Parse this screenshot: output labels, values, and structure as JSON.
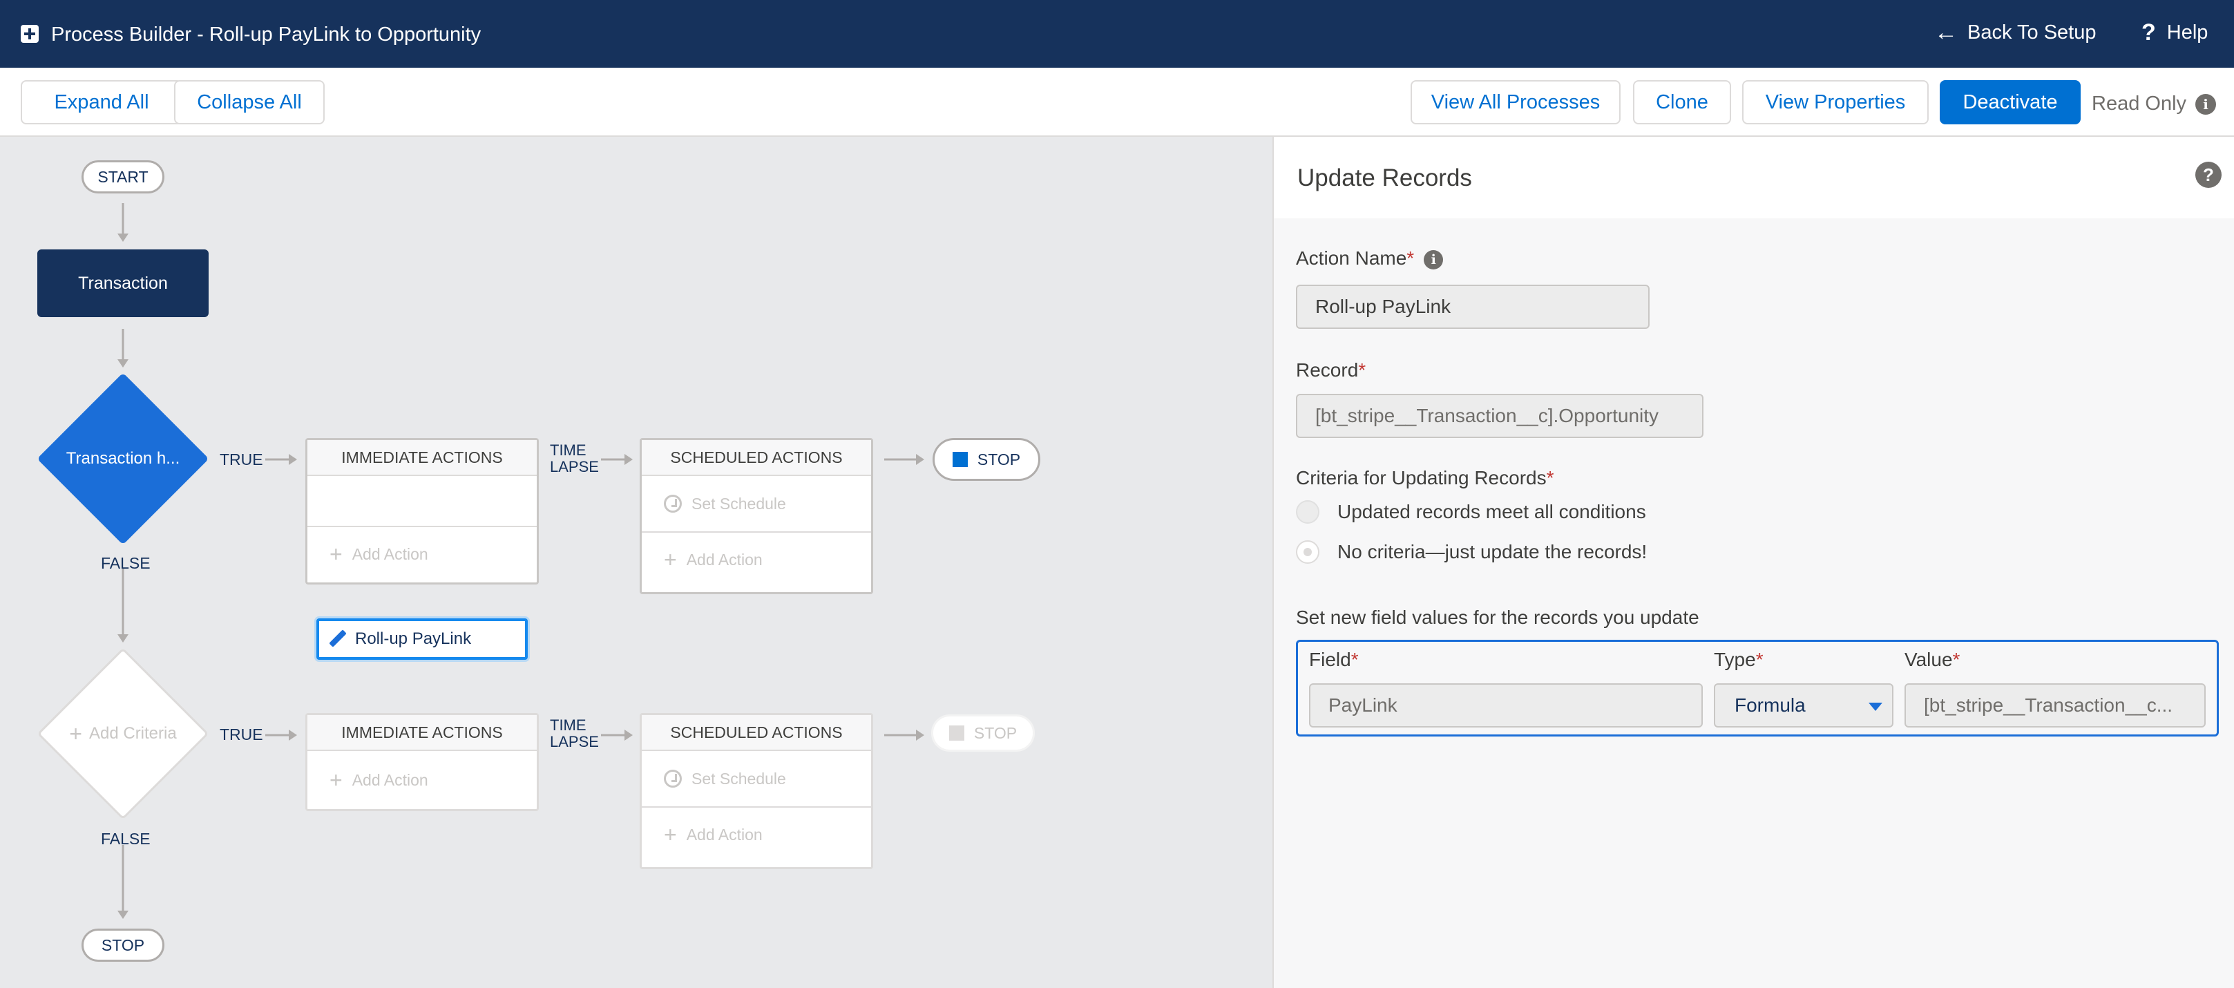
{
  "header": {
    "title": "Process Builder - Roll-up PayLink to Opportunity",
    "back_label": "Back To Setup",
    "help_label": "Help"
  },
  "toolbar": {
    "expand_all": "Expand All",
    "collapse_all": "Collapse All",
    "view_all_processes": "View All Processes",
    "clone": "Clone",
    "view_properties": "View Properties",
    "deactivate": "Deactivate",
    "read_only": "Read Only"
  },
  "canvas": {
    "start": "START",
    "object_node": "Transaction",
    "criteria_1": "Transaction h...",
    "criteria_2": "Add Criteria",
    "true_label": "TRUE",
    "false_label": "FALSE",
    "time_lapse_line1": "TIME",
    "time_lapse_line2": "LAPSE",
    "immediate_actions": "IMMEDIATE ACTIONS",
    "scheduled_actions": "SCHEDULED ACTIONS",
    "selected_action": "Roll-up PayLink",
    "add_action": "Add Action",
    "set_schedule": "Set Schedule",
    "stop": "STOP"
  },
  "panel": {
    "title": "Update Records",
    "action_name_label": "Action Name",
    "action_name_value": "Roll-up PayLink",
    "record_label": "Record",
    "record_value": "[bt_stripe__Transaction__c].Opportunity",
    "criteria_label": "Criteria for Updating Records",
    "criteria_option_1": "Updated records meet all conditions",
    "criteria_option_2": "No criteria—just update the records!",
    "set_values_label": "Set new field values for the records you update",
    "col_field": "Field",
    "col_type": "Type",
    "col_value": "Value",
    "row_field": "PayLink",
    "row_type": "Formula",
    "row_value": "[bt_stripe__Transaction__c..."
  },
  "colors": {
    "header_bg": "#16325c",
    "brand": "#0070d2",
    "criteria_blue": "#1b6ed8",
    "canvas_bg": "#e8e9eb",
    "required": "#c23934"
  },
  "icons": {
    "app": "process-builder-icon",
    "back": "arrow-left-icon",
    "help": "question-icon",
    "info": "info-icon",
    "edit": "pencil-icon",
    "add": "plus-icon",
    "schedule": "clock-icon",
    "stop": "stop-square-icon"
  }
}
